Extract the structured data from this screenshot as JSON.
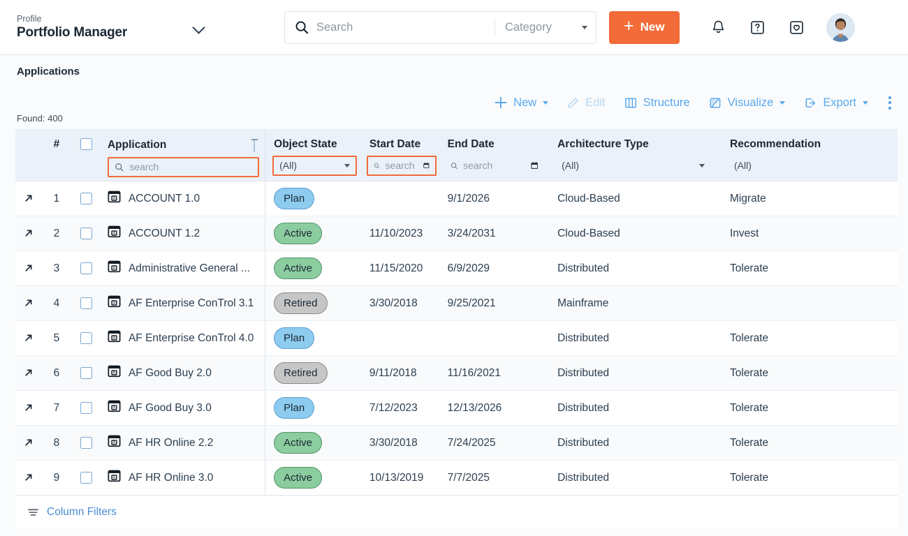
{
  "header": {
    "profile_label": "Profile",
    "profile_name": "Portfolio Manager",
    "search_placeholder": "Search",
    "category_label": "Category",
    "new_button": "New",
    "icons": [
      "bell-icon",
      "help-icon",
      "bookmark-icon",
      "avatar"
    ]
  },
  "page": {
    "title": "Applications",
    "found": "Found: 400"
  },
  "toolbar": {
    "new": "New",
    "edit": "Edit",
    "structure": "Structure",
    "visualize": "Visualize",
    "export": "Export"
  },
  "table": {
    "columns": [
      {
        "key": "num",
        "title": "#"
      },
      {
        "key": "check",
        "title": ""
      },
      {
        "key": "application",
        "title": "Application",
        "filter_type": "search",
        "filter_placeholder": "search",
        "filter_highlighted": true,
        "sorted": "asc"
      },
      {
        "key": "object_state",
        "title": "Object State",
        "filter_type": "select",
        "filter_value": "(All)",
        "filter_highlighted": true
      },
      {
        "key": "start_date",
        "title": "Start Date",
        "filter_type": "date-search",
        "filter_placeholder": "search",
        "filter_highlighted": true
      },
      {
        "key": "end_date",
        "title": "End Date",
        "filter_type": "date-search",
        "filter_placeholder": "search",
        "filter_highlighted": false
      },
      {
        "key": "architecture_type",
        "title": "Architecture Type",
        "filter_type": "select",
        "filter_value": "(All)",
        "filter_highlighted": false
      },
      {
        "key": "recommendation",
        "title": "Recommendation",
        "filter_type": "select",
        "filter_value": "(All)",
        "filter_highlighted": false
      }
    ],
    "rows": [
      {
        "num": "1",
        "application": "ACCOUNT 1.0",
        "object_state": "Plan",
        "state_class": "plan",
        "start_date": "",
        "end_date": "9/1/2026",
        "architecture_type": "Cloud-Based",
        "recommendation": "Migrate"
      },
      {
        "num": "2",
        "application": "ACCOUNT 1.2",
        "object_state": "Active",
        "state_class": "active",
        "start_date": "11/10/2023",
        "end_date": "3/24/2031",
        "architecture_type": "Cloud-Based",
        "recommendation": "Invest"
      },
      {
        "num": "3",
        "application": "Administrative General ...",
        "object_state": "Active",
        "state_class": "active",
        "start_date": "11/15/2020",
        "end_date": "6/9/2029",
        "architecture_type": "Distributed",
        "recommendation": "Tolerate"
      },
      {
        "num": "4",
        "application": "AF Enterprise ConTrol 3.1",
        "object_state": "Retired",
        "state_class": "retired",
        "start_date": "3/30/2018",
        "end_date": "9/25/2021",
        "architecture_type": "Mainframe",
        "recommendation": ""
      },
      {
        "num": "5",
        "application": "AF Enterprise ConTrol 4.0",
        "object_state": "Plan",
        "state_class": "plan",
        "start_date": "",
        "end_date": "",
        "architecture_type": "Distributed",
        "recommendation": "Tolerate"
      },
      {
        "num": "6",
        "application": "AF Good Buy 2.0",
        "object_state": "Retired",
        "state_class": "retired",
        "start_date": "9/11/2018",
        "end_date": "11/16/2021",
        "architecture_type": "Distributed",
        "recommendation": "Tolerate"
      },
      {
        "num": "7",
        "application": "AF Good Buy 3.0",
        "object_state": "Plan",
        "state_class": "plan",
        "start_date": "7/12/2023",
        "end_date": "12/13/2026",
        "architecture_type": "Distributed",
        "recommendation": "Tolerate"
      },
      {
        "num": "8",
        "application": "AF HR Online 2.2",
        "object_state": "Active",
        "state_class": "active",
        "start_date": "3/30/2018",
        "end_date": "7/24/2025",
        "architecture_type": "Distributed",
        "recommendation": "Tolerate"
      },
      {
        "num": "9",
        "application": "AF HR Online 3.0",
        "object_state": "Active",
        "state_class": "active",
        "start_date": "10/13/2019",
        "end_date": "7/7/2025",
        "architecture_type": "Distributed",
        "recommendation": "Tolerate"
      }
    ]
  },
  "footer": {
    "column_filters": "Column Filters"
  },
  "colors": {
    "accent_orange": "#f26b38",
    "link_blue": "#5aa9ef",
    "header_bg": "#eaf1f9",
    "badge_plan": "#8dccef",
    "badge_active": "#8ccda0",
    "badge_retired": "#c6c6c6"
  }
}
